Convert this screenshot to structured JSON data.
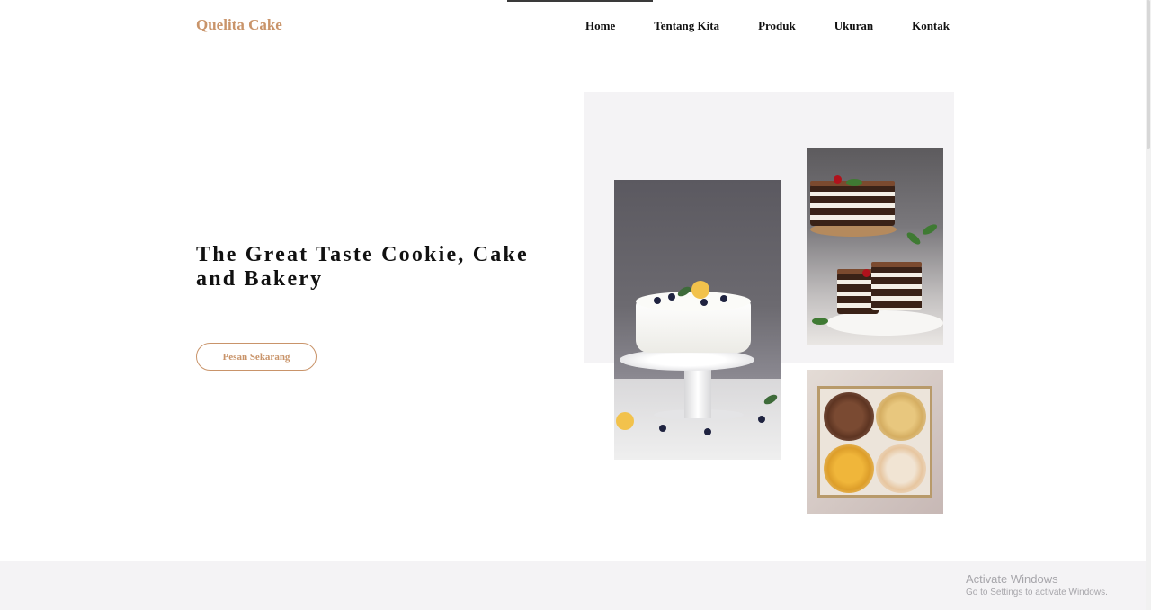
{
  "header": {
    "brand": "Quelita Cake",
    "nav": [
      "Home",
      "Tentang Kita",
      "Produk",
      "Ukuran",
      "Kontak"
    ]
  },
  "hero": {
    "title": "The Great Taste Cookie, Cake and Bakery",
    "cta_label": "Pesan Sekarang"
  },
  "gallery": {
    "images": [
      {
        "name": "white-cake-photo"
      },
      {
        "name": "chocolate-cake-photo"
      },
      {
        "name": "cookies-jars-photo"
      }
    ]
  },
  "watermark": {
    "title": "Activate Windows",
    "subtitle": "Go to Settings to activate Windows."
  },
  "colors": {
    "accent": "#c9946a",
    "panel": "#f4f3f5",
    "text": "#111111"
  }
}
